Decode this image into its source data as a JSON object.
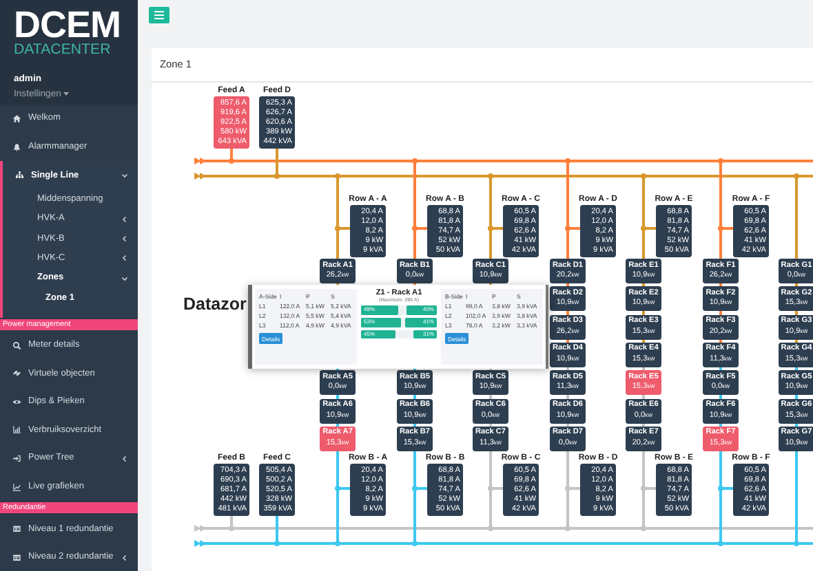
{
  "sidebar": {
    "brand": "DCEM",
    "brand_sub": "DATACENTER",
    "user": "admin",
    "user_menu": "Instellingen",
    "groups": [
      {
        "items": [
          {
            "label": "Welkom",
            "selected": false
          },
          {
            "label": "Alarmmanager",
            "selected": false
          },
          {
            "label": "Single Line",
            "selected": true,
            "expanded": true,
            "children": [
              {
                "label": "Middenspanning",
                "selected": false
              },
              {
                "label": "HVK-A",
                "selected": false,
                "expanded": false
              },
              {
                "label": "HVK-B",
                "selected": false,
                "expanded": false
              },
              {
                "label": "HVK-C",
                "selected": false,
                "expanded": false
              },
              {
                "label": "Zones",
                "selected": true,
                "expanded": true,
                "children": [
                  {
                    "label": "Zone 1",
                    "selected": true
                  }
                ]
              }
            ]
          }
        ]
      },
      {
        "header": "Power management",
        "items": [
          {
            "label": "Meter details",
            "selected": false
          },
          {
            "label": "Virtuele objecten",
            "selected": false
          },
          {
            "label": "Dips & Pieken",
            "selected": false
          },
          {
            "label": "Verbruiksoverzicht",
            "selected": false
          },
          {
            "label": "Power Tree",
            "selected": false,
            "expanded": false
          },
          {
            "label": "Live grafieken",
            "selected": false
          }
        ]
      },
      {
        "header": "Redundantie",
        "items": [
          {
            "label": "Niveau 1 redundantie",
            "selected": false
          },
          {
            "label": "Niveau 2 redundantie",
            "selected": false,
            "expanded": false
          }
        ]
      }
    ]
  },
  "page_title": "Zone 1",
  "heading": "Datazor",
  "diagram": {
    "top_buses": [
      {
        "kind": "outer",
        "color": "#ff7f3a"
      },
      {
        "kind": "inner",
        "color": "#d9972e"
      }
    ],
    "bottom_buses": [
      {
        "kind": "inner",
        "color": "#c4c4c4"
      },
      {
        "kind": "outer",
        "color": "#3cc8f0"
      }
    ],
    "top_feeds": [
      {
        "name": "Feed A",
        "alarm": true,
        "lines": [
          "857,6 A",
          "919,6 A",
          "922,5 A",
          "580 kW",
          "643 kVA"
        ],
        "link": {
          "kind": "outer",
          "color": "#ff7f3a"
        }
      },
      {
        "name": "Feed D",
        "alarm": false,
        "lines": [
          "625,3 A",
          "626,7 A",
          "620,6 A",
          "389 kW",
          "442 kVA"
        ],
        "link": {
          "kind": "inner",
          "color": "#d9972e"
        }
      }
    ],
    "bottom_feeds": [
      {
        "name": "Feed B",
        "alarm": false,
        "lines": [
          "704,3 A",
          "690,3 A",
          "681,7 A",
          "442 kW",
          "481 kVA"
        ],
        "link": {
          "kind": "inner",
          "color": "#c4c4c4"
        }
      },
      {
        "name": "Feed C",
        "alarm": false,
        "lines": [
          "505,4 A",
          "500,2 A",
          "520,5 A",
          "328 kW",
          "359 kVA"
        ],
        "link": {
          "kind": "outer",
          "color": "#3cc8f0"
        }
      }
    ],
    "columns": [
      {
        "top_row": {
          "name": "Row A - A",
          "lines": [
            "20,4 A",
            "12,0 A",
            "8,2 A",
            "9 kW",
            "9 kVA"
          ]
        },
        "links": [
          {
            "kind": "inner",
            "color": "#d9972e"
          },
          {
            "kind": "outer",
            "color": "#3cc8f0"
          }
        ],
        "racks": [
          {
            "name": "Rack A1",
            "value": "26,2",
            "unit": "kW",
            "alarm": false
          },
          {
            "name": "Rack A5",
            "value": "0,0",
            "unit": "kW",
            "alarm": false
          },
          {
            "name": "Rack A6",
            "value": "10,9",
            "unit": "kW",
            "alarm": false
          },
          {
            "name": "Rack A7",
            "value": "15,3",
            "unit": "kW",
            "alarm": true
          }
        ],
        "bottom_row": {
          "name": "Row B - A",
          "lines": [
            "20,4 A",
            "12,0 A",
            "8,2 A",
            "9 kW",
            "9 kVA"
          ]
        }
      },
      {
        "top_row": {
          "name": "Row A - B",
          "lines": [
            "68,8 A",
            "81,8 A",
            "74,7 A",
            "52 kW",
            "50 kVA"
          ]
        },
        "links": [
          {
            "kind": "outer",
            "color": "#ff7f3a"
          },
          {
            "kind": "outer",
            "color": "#3cc8f0"
          }
        ],
        "racks": [
          {
            "name": "Rack B1",
            "value": "0,0",
            "unit": "kW",
            "alarm": false
          },
          {
            "name": "Rack B5",
            "value": "10,9",
            "unit": "kW",
            "alarm": false
          },
          {
            "name": "Rack B6",
            "value": "10,9",
            "unit": "kW",
            "alarm": false
          },
          {
            "name": "Rack B7",
            "value": "15,3",
            "unit": "kW",
            "alarm": false
          }
        ],
        "bottom_row": {
          "name": "Row B - B",
          "lines": [
            "68,8 A",
            "81,8 A",
            "74,7 A",
            "52 kW",
            "50 kVA"
          ]
        }
      },
      {
        "top_row": {
          "name": "Row A - C",
          "lines": [
            "60,5 A",
            "69,8 A",
            "62,6 A",
            "41 kW",
            "42 kVA"
          ]
        },
        "links": [
          {
            "kind": "inner",
            "color": "#d9972e"
          },
          {
            "kind": "inner",
            "color": "#c4c4c4"
          }
        ],
        "racks": [
          {
            "name": "Rack C1",
            "value": "10,9",
            "unit": "kW",
            "alarm": false
          },
          {
            "name": "Rack C5",
            "value": "10,9",
            "unit": "kW",
            "alarm": false
          },
          {
            "name": "Rack C6",
            "value": "0,0",
            "unit": "kW",
            "alarm": false
          },
          {
            "name": "Rack C7",
            "value": "11,3",
            "unit": "kW",
            "alarm": false
          }
        ],
        "bottom_row": {
          "name": "Row B - C",
          "lines": [
            "60,5 A",
            "69,8 A",
            "62,6 A",
            "41 kW",
            "42 kVA"
          ]
        }
      },
      {
        "top_row": {
          "name": "Row A - D",
          "lines": [
            "20,4 A",
            "12,0 A",
            "8,2 A",
            "9 kW",
            "9 kVA"
          ]
        },
        "links": [
          {
            "kind": "outer",
            "color": "#ff7f3a"
          },
          {
            "kind": "inner",
            "color": "#c4c4c4"
          }
        ],
        "racks": [
          {
            "name": "Rack D1",
            "value": "20,2",
            "unit": "kW",
            "alarm": false
          },
          {
            "name": "Rack D2",
            "value": "10,9",
            "unit": "kW",
            "alarm": false
          },
          {
            "name": "Rack D3",
            "value": "26,2",
            "unit": "kW",
            "alarm": false
          },
          {
            "name": "Rack D4",
            "value": "10,9",
            "unit": "kW",
            "alarm": false
          },
          {
            "name": "Rack D5",
            "value": "11,3",
            "unit": "kW",
            "alarm": false
          },
          {
            "name": "Rack D6",
            "value": "10,9",
            "unit": "kW",
            "alarm": false
          },
          {
            "name": "Rack D7",
            "value": "0,0",
            "unit": "kW",
            "alarm": false
          }
        ],
        "bottom_row": {
          "name": "Row B - D",
          "lines": [
            "20,4 A",
            "12,0 A",
            "8,2 A",
            "9 kW",
            "9 kVA"
          ]
        }
      },
      {
        "top_row": {
          "name": "Row A - E",
          "lines": [
            "68,8 A",
            "81,8 A",
            "74,7 A",
            "52 kW",
            "50 kVA"
          ]
        },
        "links": [
          {
            "kind": "inner",
            "color": "#d9972e"
          },
          {
            "kind": "inner",
            "color": "#c4c4c4"
          }
        ],
        "racks": [
          {
            "name": "Rack E1",
            "value": "10,9",
            "unit": "kW",
            "alarm": false
          },
          {
            "name": "Rack E2",
            "value": "10,9",
            "unit": "kW",
            "alarm": false
          },
          {
            "name": "Rack E3",
            "value": "15,3",
            "unit": "kW",
            "alarm": false
          },
          {
            "name": "Rack E4",
            "value": "15,3",
            "unit": "kW",
            "alarm": false
          },
          {
            "name": "Rack E5",
            "value": "15,3",
            "unit": "kW",
            "alarm": true
          },
          {
            "name": "Rack E6",
            "value": "0,0",
            "unit": "kW",
            "alarm": false
          },
          {
            "name": "Rack E7",
            "value": "20,2",
            "unit": "kW",
            "alarm": false
          }
        ],
        "bottom_row": {
          "name": "Row B - E",
          "lines": [
            "68,8 A",
            "81,8 A",
            "74,7 A",
            "52 kW",
            "50 kVA"
          ]
        }
      },
      {
        "top_row": {
          "name": "Row A - F",
          "lines": [
            "60,5 A",
            "69,8 A",
            "62,6 A",
            "41 kW",
            "42 kVA"
          ]
        },
        "links": [
          {
            "kind": "outer",
            "color": "#ff7f3a"
          },
          {
            "kind": "outer",
            "color": "#3cc8f0"
          }
        ],
        "racks": [
          {
            "name": "Rack F1",
            "value": "26,2",
            "unit": "kW",
            "alarm": false
          },
          {
            "name": "Rack F2",
            "value": "10,9",
            "unit": "kW",
            "alarm": false
          },
          {
            "name": "Rack F3",
            "value": "20,2",
            "unit": "kW",
            "alarm": false
          },
          {
            "name": "Rack F4",
            "value": "11,3",
            "unit": "kW",
            "alarm": false
          },
          {
            "name": "Rack F5",
            "value": "0,0",
            "unit": "kW",
            "alarm": false
          },
          {
            "name": "Rack F6",
            "value": "10,9",
            "unit": "kW",
            "alarm": false
          },
          {
            "name": "Rack F7",
            "value": "15,3",
            "unit": "kW",
            "alarm": true
          }
        ],
        "bottom_row": {
          "name": "Row B - F",
          "lines": [
            "60,5 A",
            "69,8 A",
            "62,6 A",
            "41 kW",
            "42 kVA"
          ]
        }
      },
      {
        "links": [
          {
            "kind": "inner",
            "color": "#d9972e"
          },
          {
            "kind": "outer",
            "color": "#3cc8f0"
          }
        ],
        "racks": [
          {
            "name": "Rack G1",
            "value": "0,0",
            "unit": "kW",
            "alarm": false
          },
          {
            "name": "Rack G2",
            "value": "15,3",
            "unit": "kW",
            "alarm": false
          },
          {
            "name": "Rack G3",
            "value": "10,9",
            "unit": "kW",
            "alarm": false
          },
          {
            "name": "Rack G4",
            "value": "15,3",
            "unit": "kW",
            "alarm": false
          },
          {
            "name": "Rack G5",
            "value": "10,9",
            "unit": "kW",
            "alarm": false
          },
          {
            "name": "Rack G6",
            "value": "15,3",
            "unit": "kW",
            "alarm": false
          },
          {
            "name": "Rack G7",
            "value": "10,9",
            "unit": "kW",
            "alarm": false
          }
        ]
      }
    ]
  },
  "popup": {
    "title": "Z1 - Rack A1",
    "subtitle": "(Maximum: 280 A)",
    "sides": [
      {
        "columns": [
          "A-Side",
          "I",
          "P",
          "S"
        ],
        "rows": [
          [
            "L1",
            "122,0 A",
            "5,1 kW",
            "5,2 kVA"
          ],
          [
            "L2",
            "132,0 A",
            "5,5 kW",
            "5,4 kVA"
          ],
          [
            "L3",
            "112,0 A",
            "4,9 kW",
            "4,9 kVA"
          ]
        ],
        "button": "Details"
      },
      {
        "columns": [
          "B-Side",
          "I",
          "P",
          "S"
        ],
        "rows": [
          [
            "L1",
            "99,0 A",
            "3,8 kW",
            "3,9 kVA"
          ],
          [
            "L2",
            "102,0 A",
            "3,9 kW",
            "3,8 kVA"
          ],
          [
            "L3",
            "78,0 A",
            "3,2 kW",
            "3,3 kVA"
          ]
        ],
        "button": "Details"
      }
    ],
    "bars": [
      {
        "a": {
          "label": "49%",
          "level": 0.49
        },
        "b": {
          "label": "40%",
          "level": 0.4
        }
      },
      {
        "a": {
          "label": "53%",
          "level": 0.53
        },
        "b": {
          "label": "41%",
          "level": 0.41
        }
      },
      {
        "a": {
          "label": "45%",
          "level": 0.45
        },
        "b": {
          "label": "31%",
          "level": 0.31
        }
      }
    ]
  }
}
